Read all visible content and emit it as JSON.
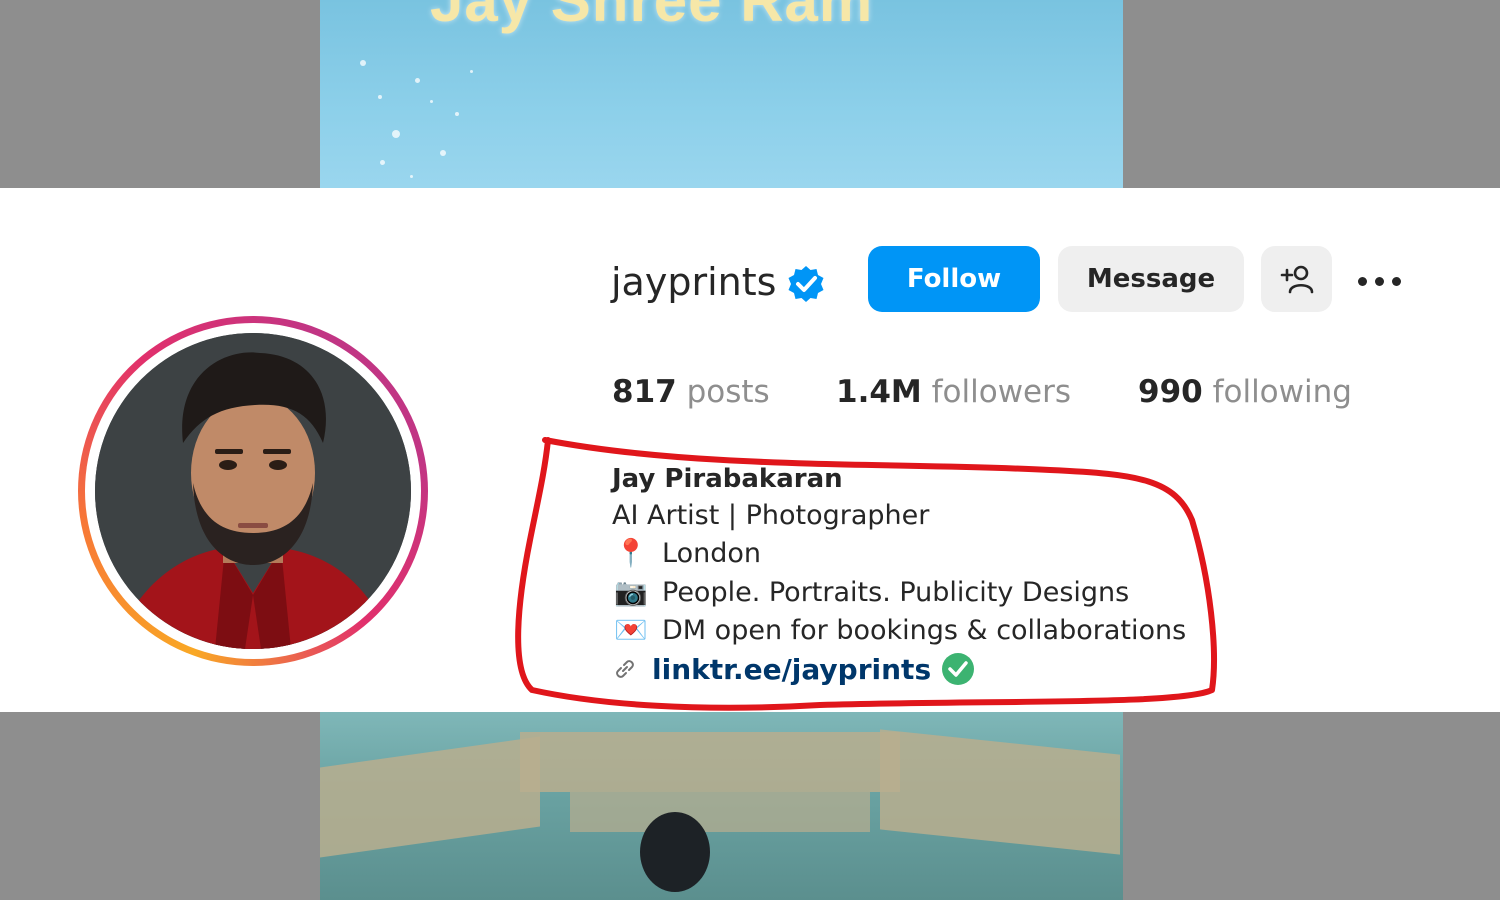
{
  "background_video": {
    "caption": "Jay Shree Ram"
  },
  "profile": {
    "username": "jayprints",
    "verified_icon": "verified-badge-icon",
    "buttons": {
      "follow": "Follow",
      "message": "Message",
      "add_user_icon": "add-user-icon",
      "more_icon": "more-options-icon"
    },
    "stats": {
      "posts_count": "817",
      "posts_label": "posts",
      "followers_count": "1.4M",
      "followers_label": "followers",
      "following_count": "990",
      "following_label": "following"
    },
    "bio": {
      "name": "Jay Pirabakaran",
      "tagline": "AI Artist | Photographer",
      "lines": [
        {
          "icon": "pushpin-icon",
          "emoji": "📍",
          "text": "London"
        },
        {
          "icon": "camera-icon",
          "emoji": "📷",
          "text": "People. Portraits. Publicity Designs"
        },
        {
          "icon": "love-letter-icon",
          "emoji": "💌",
          "text": "DM open for bookings & collaborations"
        }
      ],
      "link": "linktr.ee/jayprints",
      "link_icon": "link-icon"
    }
  },
  "colors": {
    "follow_blue": "#0095f6",
    "annotation_red": "#e0161b",
    "link_text": "#00376b",
    "link_check_green": "#3cb371"
  }
}
